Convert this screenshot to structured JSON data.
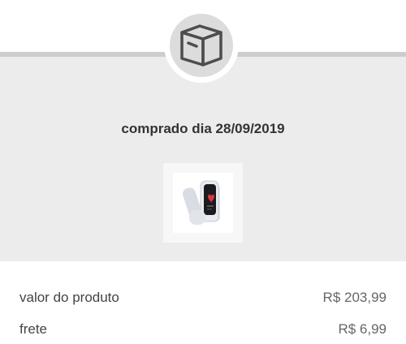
{
  "order": {
    "purchased_label": "comprado dia 28/09/2019",
    "product_image_icon": "fitness-band-image",
    "header_icon": "box-icon"
  },
  "summary": {
    "product_value_label": "valor do produto",
    "product_value": "R$ 203,99",
    "shipping_label": "frete",
    "shipping_value": "R$ 6,99"
  },
  "colors": {
    "band_background": "#ececec",
    "divider": "#cdcdcd",
    "text_primary": "#333333",
    "text_value": "#666666"
  }
}
